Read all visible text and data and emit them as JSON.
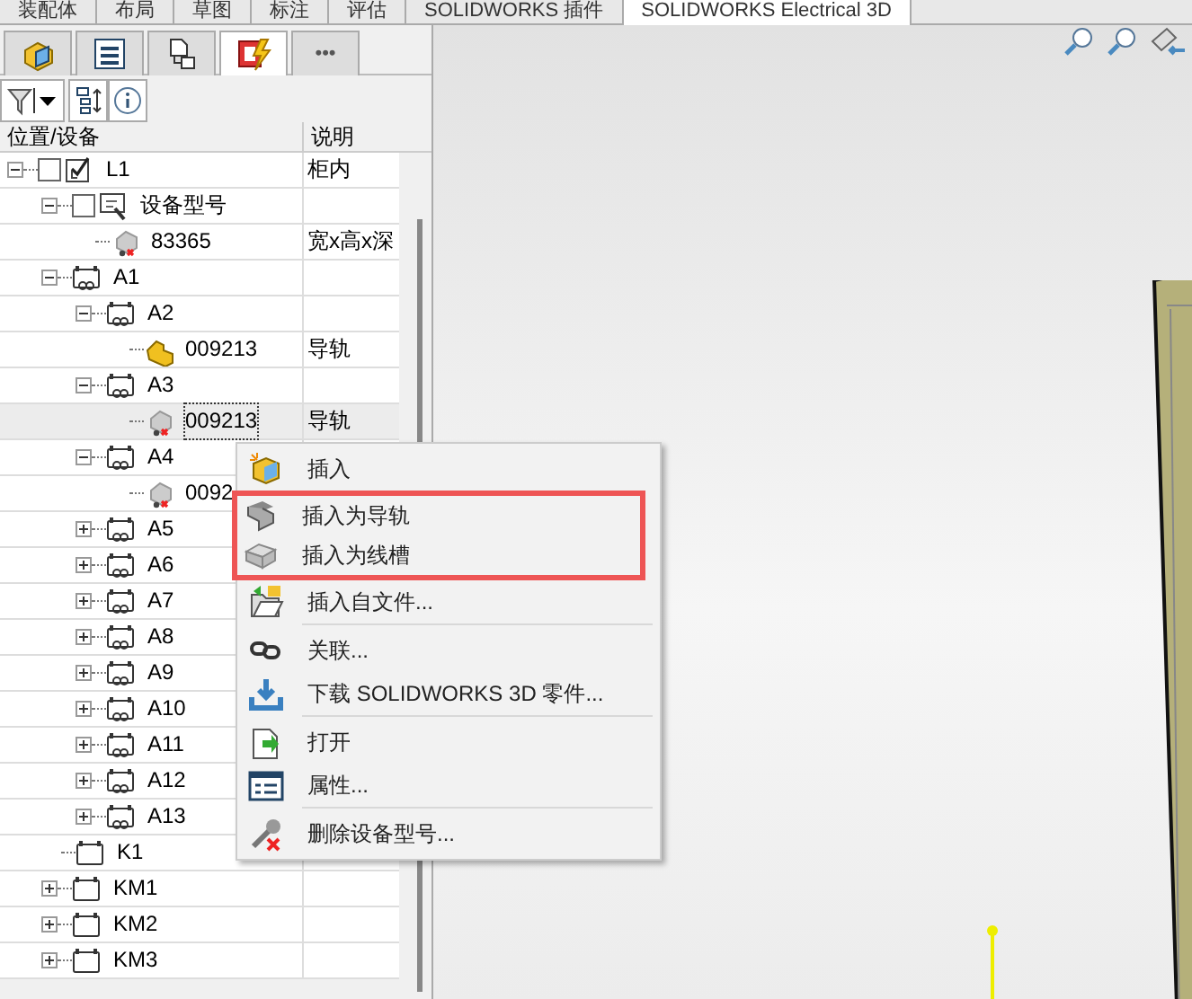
{
  "ribbon_tabs": [
    {
      "label": "装配体",
      "selected": false
    },
    {
      "label": "布局",
      "selected": false
    },
    {
      "label": "草图",
      "selected": false
    },
    {
      "label": "标注",
      "selected": false
    },
    {
      "label": "评估",
      "selected": false
    },
    {
      "label": "SOLIDWORKS 插件",
      "selected": false
    },
    {
      "label": "SOLIDWORKS Electrical 3D",
      "selected": true
    }
  ],
  "panel_tabs": [
    {
      "kind": "assembly",
      "selected": false
    },
    {
      "kind": "list",
      "selected": false
    },
    {
      "kind": "tree",
      "selected": false
    },
    {
      "kind": "electrical",
      "selected": true
    },
    {
      "kind": "more",
      "label": "•••",
      "selected": false
    }
  ],
  "tree": {
    "columns": [
      "位置/设备",
      "说明"
    ],
    "rows": [
      {
        "kind": "location",
        "label": "L1",
        "description": "柜内",
        "expanded": true,
        "checked": false,
        "selected": false,
        "children": [
          {
            "kind": "model",
            "label": "设备型号",
            "expanded": true,
            "checked": false,
            "selected": false,
            "children": [
              {
                "kind": "part-missing",
                "label": "83365",
                "description": "宽x高x深",
                "selected": false
              }
            ]
          },
          {
            "kind": "rack",
            "label": "A1",
            "expanded": true,
            "selected": false,
            "children": [
              {
                "kind": "rack",
                "label": "A2",
                "expanded": true,
                "selected": false,
                "children": [
                  {
                    "kind": "part",
                    "label": "009213",
                    "description": "导轨",
                    "selected": false
                  }
                ]
              },
              {
                "kind": "rack",
                "label": "A3",
                "expanded": true,
                "selected": false,
                "children": [
                  {
                    "kind": "part-missing",
                    "label": "009213",
                    "description": "导轨",
                    "selected": true
                  }
                ]
              },
              {
                "kind": "rack",
                "label": "A4",
                "expanded": true,
                "selected": false,
                "children": [
                  {
                    "kind": "part-missing",
                    "label": "0092",
                    "selected": false
                  }
                ]
              },
              {
                "kind": "rack",
                "label": "A5",
                "expanded": false,
                "selected": false
              },
              {
                "kind": "rack",
                "label": "A6",
                "expanded": false,
                "selected": false
              },
              {
                "kind": "rack",
                "label": "A7",
                "expanded": false,
                "selected": false
              },
              {
                "kind": "rack",
                "label": "A8",
                "expanded": false,
                "selected": false
              },
              {
                "kind": "rack",
                "label": "A9",
                "expanded": false,
                "selected": false
              },
              {
                "kind": "rack",
                "label": "A10",
                "expanded": false,
                "selected": false
              },
              {
                "kind": "rack",
                "label": "A11",
                "expanded": false,
                "selected": false
              },
              {
                "kind": "rack",
                "label": "A12",
                "expanded": false,
                "selected": false
              },
              {
                "kind": "rack",
                "label": "A13",
                "expanded": false,
                "selected": false
              }
            ]
          },
          {
            "kind": "component",
            "label": "K1",
            "selected": false
          },
          {
            "kind": "component",
            "label": "KM1",
            "expanded": false,
            "selected": false
          },
          {
            "kind": "component",
            "label": "KM2",
            "expanded": false,
            "selected": false
          },
          {
            "kind": "component",
            "label": "KM3",
            "expanded": false,
            "selected": false
          }
        ]
      }
    ]
  },
  "context_menu": [
    {
      "label": "插入",
      "highlighted": false,
      "separator_before": false
    },
    {
      "label": "插入为导轨",
      "highlighted": true,
      "separator_before": false
    },
    {
      "label": "插入为线槽",
      "highlighted": true,
      "separator_before": false
    },
    {
      "label": "插入自文件...",
      "highlighted": false,
      "separator_before": false
    },
    {
      "label": "关联...",
      "highlighted": false,
      "separator_before": true
    },
    {
      "label": "下载 SOLIDWORKS 3D 零件...",
      "highlighted": false,
      "separator_before": false
    },
    {
      "label": "打开",
      "highlighted": false,
      "separator_before": true
    },
    {
      "label": "属性...",
      "highlighted": false,
      "separator_before": false
    },
    {
      "label": "删除设备型号...",
      "highlighted": false,
      "separator_before": true
    }
  ]
}
